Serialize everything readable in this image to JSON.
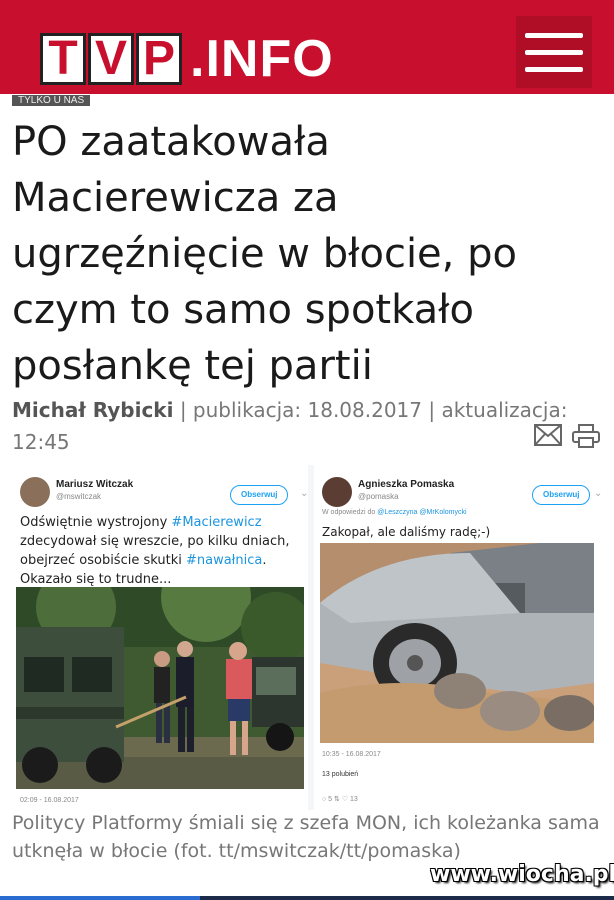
{
  "header": {
    "logo_letters": [
      "T",
      "V",
      "P"
    ],
    "logo_suffix": ".INFO",
    "menu_icon": "hamburger-menu-icon",
    "brand_color": "#c8102e"
  },
  "label": "TYLKO U NAS",
  "article": {
    "headline": "PO zaatakowała Macierewicza za ugrzęźnięcie w błocie, po czym to samo spotkało posłankę tej partii",
    "author": "Michał Rybicki",
    "meta": " | publikacja: 18.08.2017 | aktualizacja: 12:45",
    "icons": [
      "envelope-icon",
      "printer-icon"
    ]
  },
  "image": {
    "left_tweet": {
      "name": "Mariusz Witczak",
      "handle": "@mswitczak",
      "follow_label": "Obserwuj",
      "text_before": "Odświętnie wystrojony ",
      "tag1": "#Macierewicz",
      "text_middle": " zdecydował się wreszcie, po kilku dniach, obejrzeć osobiście skutki ",
      "tag2": "#nawałnica",
      "text_after": ". Okazało się to trudne...",
      "date": "02:09 - 16.08.2017"
    },
    "right_tweet": {
      "name": "Agnieszka Pomaska",
      "handle": "@pomaska",
      "follow_label": "Obserwuj",
      "reply_prefix": "W odpowiedzi do ",
      "reply_to": "@Leszczyna @MrKolomycki",
      "text": "Zakopał, ale daliśmy radę;-)",
      "date": "10:35 - 16.08.2017",
      "likes": "13 polubień",
      "actions": "○ 5      ⇅      ♡ 13"
    }
  },
  "caption": "Politycy Platformy śmiali się z szefa MON, ich koleżanka sama utknęła w błocie (fot. tt/mswitczak/tt/pomaska)",
  "watermark": "www.wiocha.pl"
}
